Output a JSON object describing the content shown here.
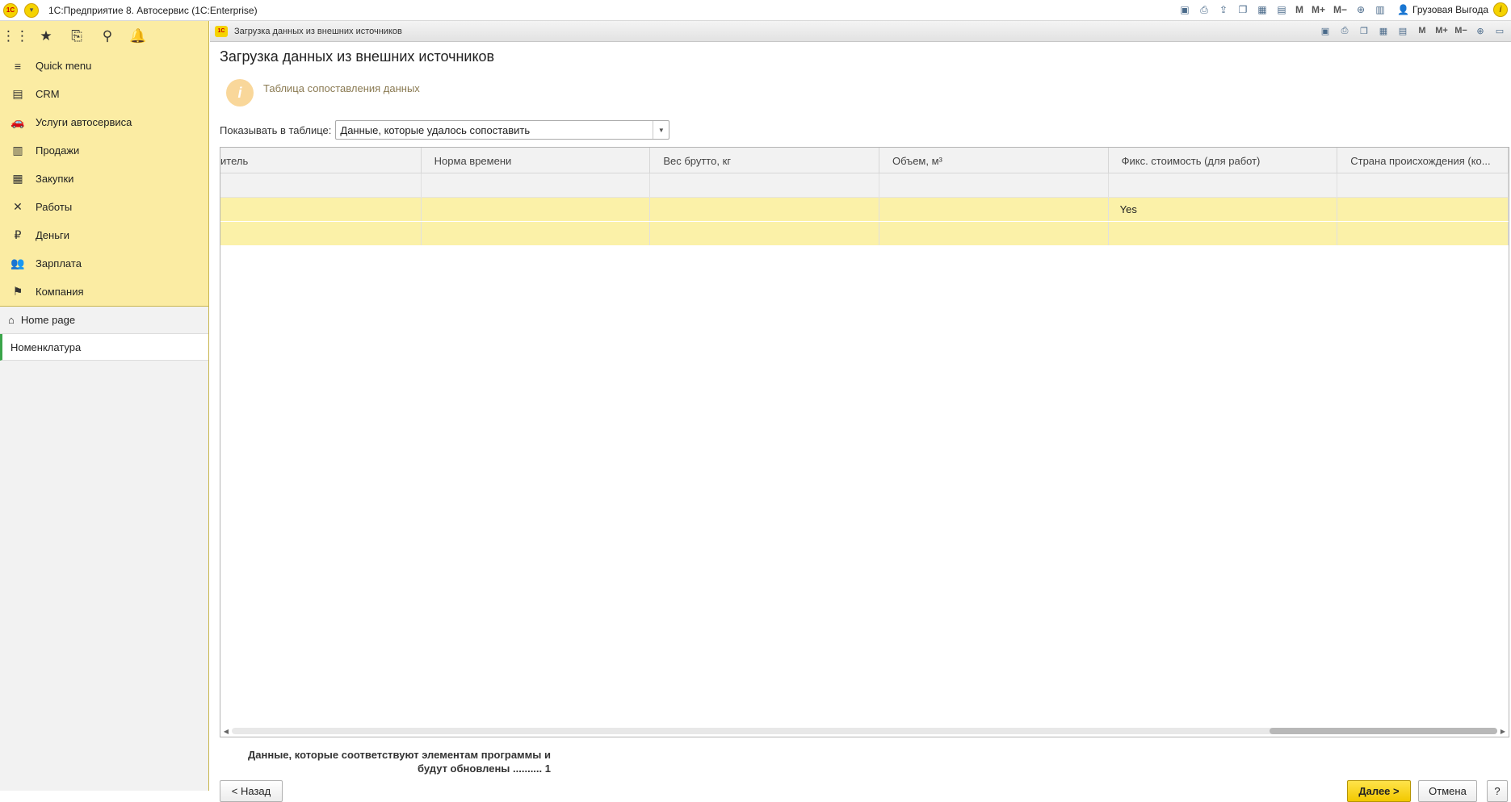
{
  "app": {
    "title": "1С:Предприятие 8. Автосервис  (1С:Enterprise)",
    "logo_text": "1С",
    "user": "Грузовая Выгода",
    "toolbar_m": [
      "M",
      "M+",
      "M−"
    ]
  },
  "sidebar": {
    "tools": [
      "apps-icon",
      "favorites-icon",
      "history-icon",
      "search-icon",
      "notifications-icon"
    ],
    "items": [
      {
        "label": "Quick menu",
        "icon": "menu-icon"
      },
      {
        "label": "CRM",
        "icon": "crm-icon"
      },
      {
        "label": "Услуги автосервиса",
        "icon": "car-icon"
      },
      {
        "label": "Продажи",
        "icon": "basket-icon"
      },
      {
        "label": "Закупки",
        "icon": "cart-icon"
      },
      {
        "label": "Работы",
        "icon": "tools-icon"
      },
      {
        "label": "Деньги",
        "icon": "ruble-icon"
      },
      {
        "label": "Зарплата",
        "icon": "people-icon"
      },
      {
        "label": "Компания",
        "icon": "flag-icon"
      }
    ],
    "home": "Home page",
    "open_tab": "Номенклатура"
  },
  "window": {
    "tab_title": "Загрузка данных из внешних источников",
    "page_title": "Загрузка данных из внешних источников",
    "info_text": "Таблица сопоставления данных",
    "filter_label": "Показывать в таблице:",
    "filter_value": "Данные, которые удалось сопоставить"
  },
  "table": {
    "columns": [
      "итель",
      "Норма времени",
      "Вес брутто, кг",
      "Объем, м³",
      "Фикс. стоимость (для работ)",
      "Страна происхождения (ко..."
    ],
    "rows": [
      [
        "",
        "",
        "",
        "",
        "Yes",
        ""
      ],
      [
        "",
        "",
        "",
        "",
        "",
        ""
      ]
    ],
    "scroll_position": 0.85
  },
  "summary": {
    "line1": "Данные, которые соответствуют элементам программы и",
    "line2": "будут обновлены .......... 1"
  },
  "buttons": {
    "back": "< Назад",
    "next": "Далее >",
    "cancel": "Отмена",
    "help": "?"
  },
  "colors": {
    "sidebar_bg": "#fbeca3",
    "highlight_row": "#fbf1a8",
    "primary_button": "#f2c800",
    "active_marker": "#3aa54a"
  }
}
